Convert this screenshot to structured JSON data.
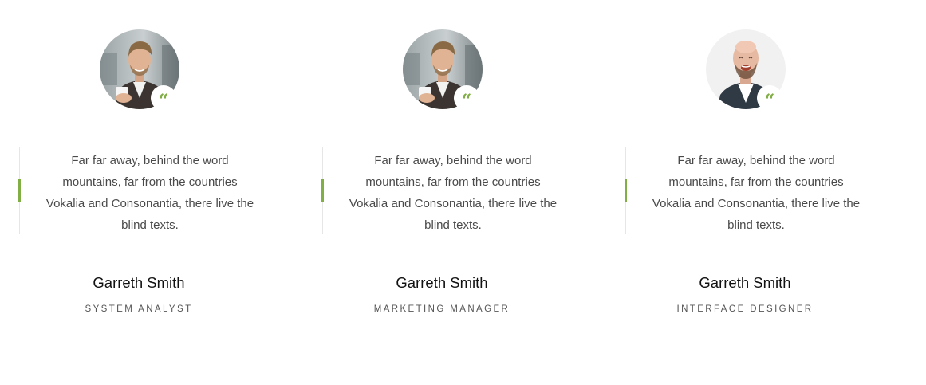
{
  "accent_color": "#82ae46",
  "quote_icon": "quote-left-icon",
  "testimonials": [
    {
      "quote": "Far far away, behind the word mountains, far from the countries Vokalia and Consonantia, there live the blind texts.",
      "name": "Garreth Smith",
      "role": "SYSTEM ANALYST",
      "quote_glyph": "“",
      "avatar": "man-with-coffee-cup-photo"
    },
    {
      "quote": "Far far away, behind the word mountains, far from the countries Vokalia and Consonantia, there live the blind texts.",
      "name": "Garreth Smith",
      "role": "MARKETING MANAGER",
      "quote_glyph": "“",
      "avatar": "man-with-coffee-cup-photo"
    },
    {
      "quote": "Far far away, behind the word mountains, far from the countries Vokalia and Consonantia, there live the blind texts.",
      "name": "Garreth Smith",
      "role": "INTERFACE DESIGNER",
      "quote_glyph": "“",
      "avatar": "bald-man-laughing-photo"
    }
  ]
}
